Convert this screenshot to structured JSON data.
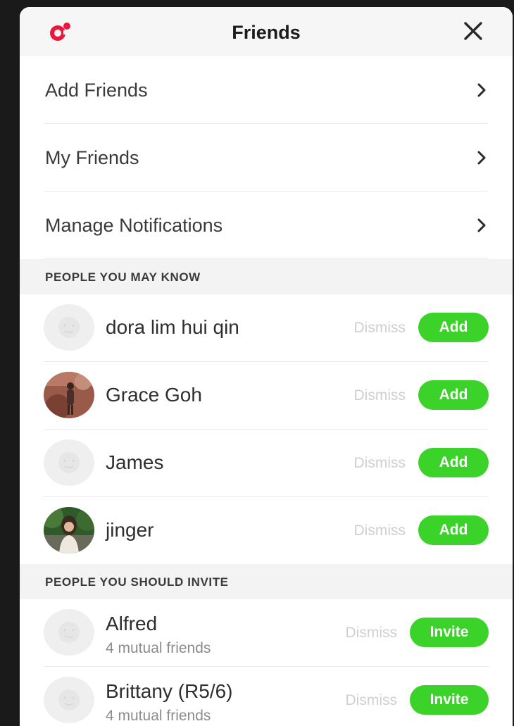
{
  "header": {
    "title": "Friends",
    "logo_icon": "app-logo-icon",
    "close_icon": "close-icon"
  },
  "menu": [
    {
      "label": "Add Friends"
    },
    {
      "label": "My Friends"
    },
    {
      "label": "Manage Notifications"
    }
  ],
  "sections": {
    "people_you_may_know": {
      "title": "PEOPLE YOU MAY KNOW",
      "people": [
        {
          "name": "dora lim hui qin",
          "avatar": "placeholder",
          "dismiss": "Dismiss",
          "action": "Add"
        },
        {
          "name": "Grace Goh",
          "avatar": "photo",
          "dismiss": "Dismiss",
          "action": "Add"
        },
        {
          "name": "James",
          "avatar": "placeholder",
          "dismiss": "Dismiss",
          "action": "Add"
        },
        {
          "name": "jinger",
          "avatar": "photo",
          "dismiss": "Dismiss",
          "action": "Add"
        }
      ]
    },
    "people_you_should_invite": {
      "title": "PEOPLE YOU SHOULD INVITE",
      "people": [
        {
          "name": "Alfred",
          "subtitle": "4 mutual friends",
          "avatar": "placeholder",
          "dismiss": "Dismiss",
          "action": "Invite"
        },
        {
          "name": "Brittany (R5/6)",
          "subtitle": "4 mutual friends",
          "avatar": "placeholder",
          "dismiss": "Dismiss",
          "action": "Invite"
        }
      ]
    }
  },
  "colors": {
    "accent_green": "#3bd22a",
    "logo_red": "#e8193c",
    "dismiss_gray": "#cfcfcf"
  }
}
